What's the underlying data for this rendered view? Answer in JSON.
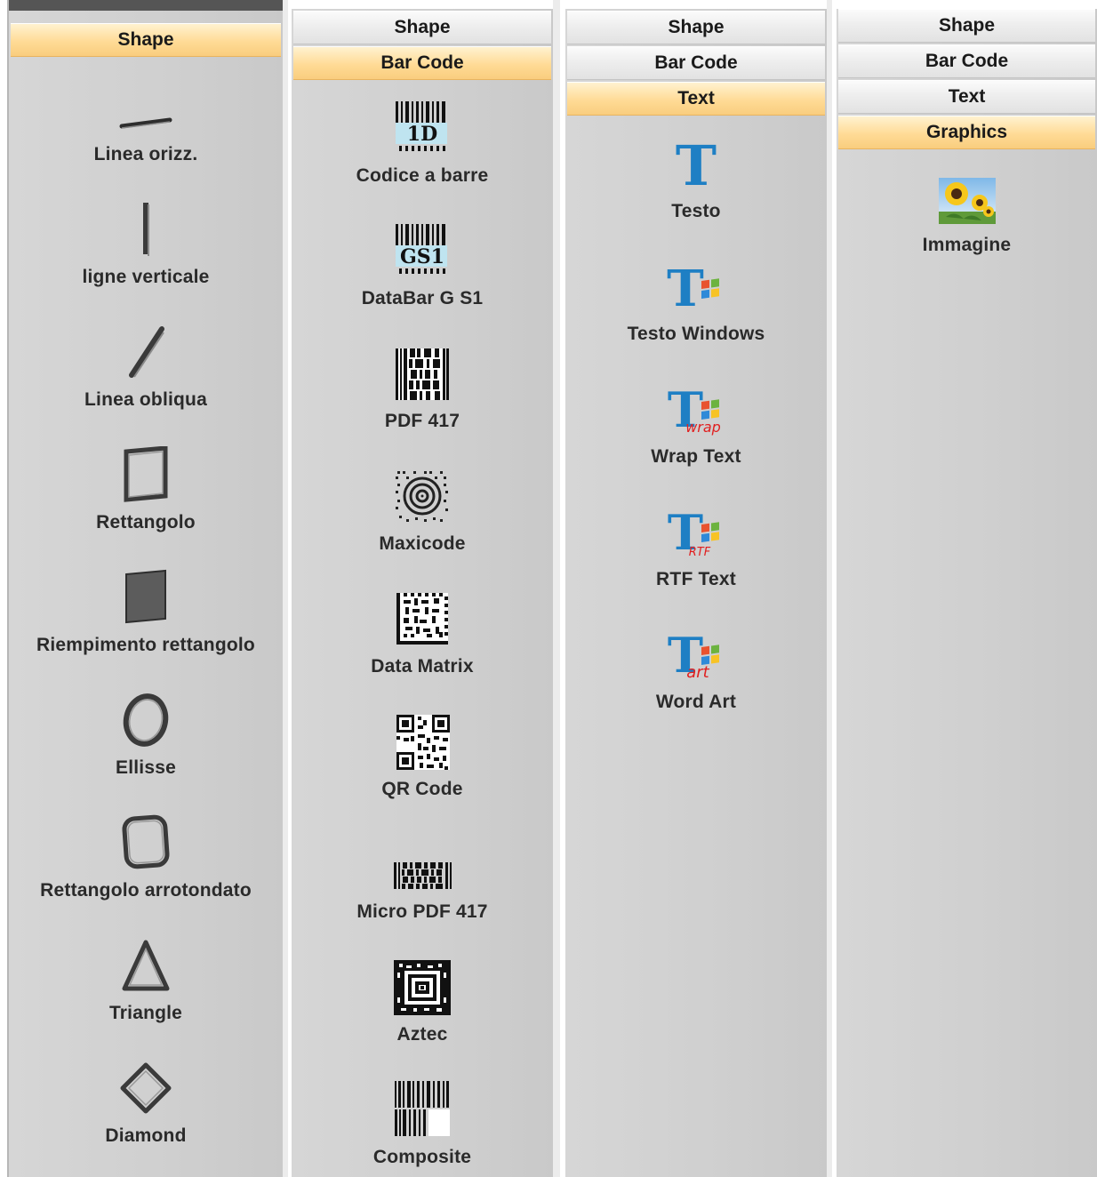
{
  "panels": {
    "shape": {
      "headers": [
        "Shape"
      ],
      "items": [
        {
          "label": "Linea orizz.",
          "icon": "horizontal-line-icon"
        },
        {
          "label": "ligne verticale",
          "icon": "vertical-line-icon"
        },
        {
          "label": "Linea obliqua",
          "icon": "oblique-line-icon"
        },
        {
          "label": "Rettangolo",
          "icon": "rectangle-icon"
        },
        {
          "label": "Riempimento rettangolo",
          "icon": "filled-rectangle-icon"
        },
        {
          "label": "Ellisse",
          "icon": "ellipse-icon"
        },
        {
          "label": "Rettangolo arrotondato",
          "icon": "rounded-rectangle-icon"
        },
        {
          "label": "Triangle",
          "icon": "triangle-icon"
        },
        {
          "label": "Diamond",
          "icon": "diamond-icon"
        }
      ]
    },
    "barcode": {
      "headers": [
        "Shape",
        "Bar Code"
      ],
      "items": [
        {
          "label": "Codice a barre",
          "icon": "barcode-1d-icon",
          "icon_text": "1D"
        },
        {
          "label": "DataBar G S1",
          "icon": "barcode-gs1-icon",
          "icon_text": "GS1"
        },
        {
          "label": "PDF 417",
          "icon": "pdf417-icon"
        },
        {
          "label": "Maxicode",
          "icon": "maxicode-icon"
        },
        {
          "label": "Data Matrix",
          "icon": "data-matrix-icon"
        },
        {
          "label": "QR Code",
          "icon": "qr-code-icon"
        },
        {
          "label": "Micro PDF 417",
          "icon": "micro-pdf417-icon"
        },
        {
          "label": "Aztec",
          "icon": "aztec-icon"
        },
        {
          "label": "Composite",
          "icon": "composite-barcode-icon"
        }
      ]
    },
    "text": {
      "headers": [
        "Shape",
        "Bar Code",
        "Text"
      ],
      "items": [
        {
          "label": "Testo",
          "icon": "text-t-icon"
        },
        {
          "label": "Testo Windows",
          "icon": "windows-text-icon"
        },
        {
          "label": "Wrap Text",
          "icon": "wrap-text-icon",
          "icon_text": "wrap"
        },
        {
          "label": "RTF Text",
          "icon": "rtf-text-icon",
          "icon_text": "RTF"
        },
        {
          "label": "Word Art",
          "icon": "word-art-icon",
          "icon_text": "art"
        }
      ]
    },
    "graphics": {
      "headers": [
        "Shape",
        "Bar Code",
        "Text",
        "Graphics"
      ],
      "items": [
        {
          "label": "Immagine",
          "icon": "image-sunflower-icon"
        }
      ]
    }
  },
  "colors": {
    "active_header": "#ffdb96",
    "panel_bg": "#cfcfcf",
    "text_icon_blue": "#1e7fc4"
  }
}
